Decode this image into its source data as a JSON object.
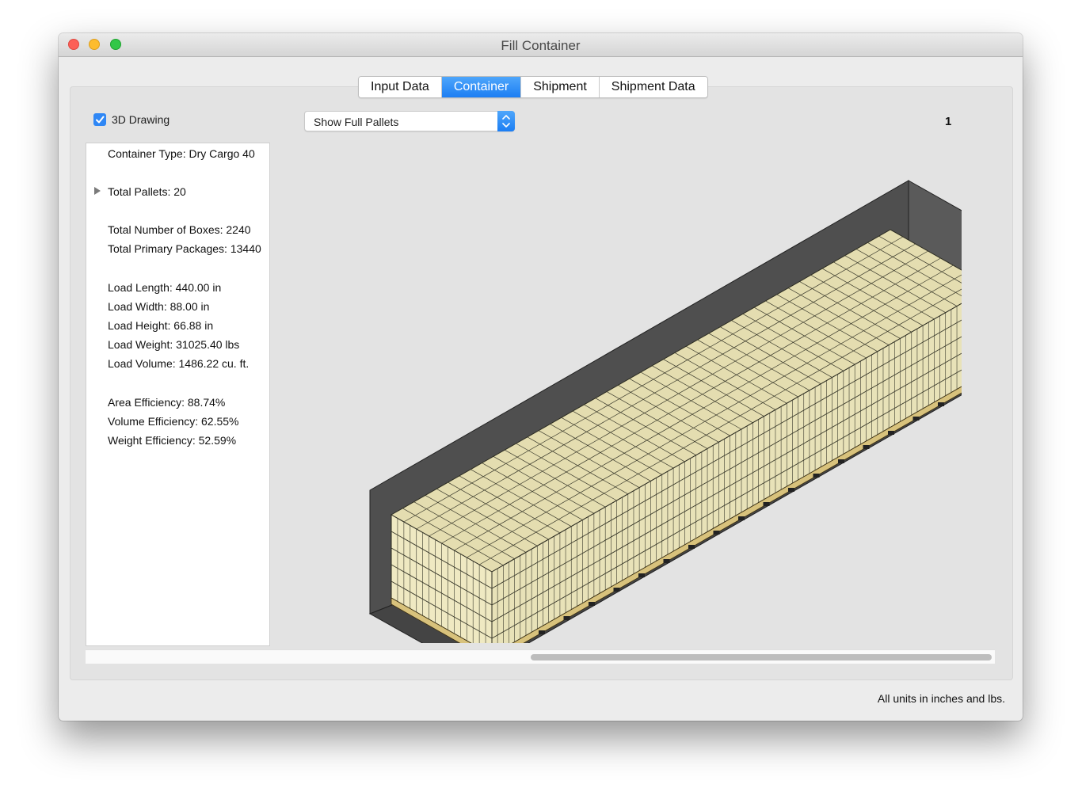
{
  "window": {
    "title": "Fill Container"
  },
  "tabs": [
    {
      "label": "Input Data",
      "active": false
    },
    {
      "label": "Container",
      "active": true
    },
    {
      "label": "Shipment",
      "active": false
    },
    {
      "label": "Shipment Data",
      "active": false
    }
  ],
  "options": {
    "drawing_3d_label": "3D Drawing",
    "drawing_3d_checked": true,
    "pallet_filter_selected": "Show Full Pallets",
    "page_number": "1"
  },
  "info": {
    "container_type": "Container Type: Dry Cargo 40",
    "total_pallets": "Total Pallets: 20",
    "total_boxes": "Total Number of Boxes: 2240",
    "total_primary_packages": "Total Primary Packages: 13440",
    "load_length": "Load Length: 440.00 in",
    "load_width": "Load Width: 88.00 in",
    "load_height": "Load Height: 66.88 in",
    "load_weight": "Load Weight: 31025.40 lbs",
    "load_volume": "Load Volume: 1486.22 cu. ft.",
    "area_efficiency": "Area Efficiency: 88.74%",
    "volume_efficiency": "Volume Efficiency: 62.55%",
    "weight_efficiency": "Weight Efficiency: 52.59%"
  },
  "footer": {
    "units_note": "All units in inches and lbs."
  },
  "colors": {
    "accent": "#1c7ef3",
    "container_wall": "#4f4f4f",
    "box_face": "#e8e2b8",
    "box_edge": "#2b2b20",
    "pallet": "#d8c27c"
  }
}
